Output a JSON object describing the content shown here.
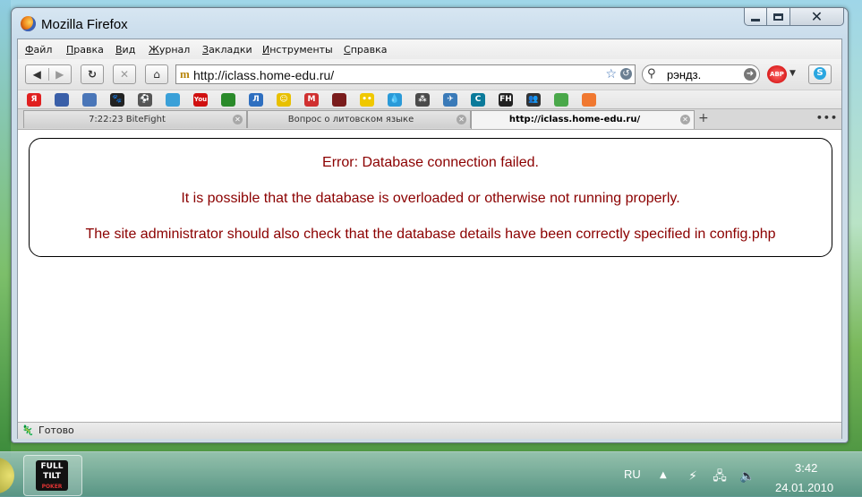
{
  "window": {
    "title": "Mozilla Firefox"
  },
  "menu": [
    "Файл",
    "Правка",
    "Вид",
    "Журнал",
    "Закладки",
    "Инструменты",
    "Справка"
  ],
  "nav": {
    "url": "http://iclass.home-edu.ru/",
    "url_favicon": "m",
    "search_text": "рэндз.",
    "abp_label": "ABP"
  },
  "bookmarks": [
    {
      "icon": "yandex-icon",
      "glyph": "Я",
      "color": "#e02020"
    },
    {
      "icon": "folder-icon",
      "glyph": "",
      "color": "#3a5fa8"
    },
    {
      "icon": "computer-icon",
      "glyph": "",
      "color": "#4a76b8"
    },
    {
      "icon": "paw-icon",
      "glyph": "🐾",
      "color": "#222"
    },
    {
      "icon": "ball-icon",
      "glyph": "⚽",
      "color": "#555"
    },
    {
      "icon": "chart-icon",
      "glyph": "",
      "color": "#3aa0d8"
    },
    {
      "icon": "youtube-icon",
      "glyph": "You",
      "color": "#d01010"
    },
    {
      "icon": "green-box-icon",
      "glyph": "",
      "color": "#2a8a2a"
    },
    {
      "icon": "blue-a-icon",
      "glyph": "Л",
      "color": "#2e6fc0"
    },
    {
      "icon": "smiley-icon",
      "glyph": "☺",
      "color": "#e8c000"
    },
    {
      "icon": "gmail-icon",
      "glyph": "M",
      "color": "#d03030"
    },
    {
      "icon": "dark-box-icon",
      "glyph": "",
      "color": "#7a1c1c"
    },
    {
      "icon": "yellow-face-icon",
      "glyph": "••",
      "color": "#f0c800"
    },
    {
      "icon": "drop-icon",
      "glyph": "💧",
      "color": "#2a9ad8"
    },
    {
      "icon": "dots-icon",
      "glyph": "⁂",
      "color": "#4a4a4a"
    },
    {
      "icon": "bird-icon",
      "glyph": "✈",
      "color": "#3a7ab8"
    },
    {
      "icon": "c-icon",
      "glyph": "C",
      "color": "#0a7a9a"
    },
    {
      "icon": "fh-icon",
      "glyph": "FH",
      "color": "#222"
    },
    {
      "icon": "people-icon",
      "glyph": "👥",
      "color": "#333"
    },
    {
      "icon": "green-swirl-icon",
      "glyph": "",
      "color": "#4aa84a"
    },
    {
      "icon": "orange-circle-icon",
      "glyph": "",
      "color": "#f07830"
    }
  ],
  "tabs": [
    {
      "label": "7:22:23 BiteFight"
    },
    {
      "label": "Вопрос о литовском языке"
    },
    {
      "label": "http://iclass.home-edu.ru/"
    }
  ],
  "content": {
    "line1": "Error: Database connection failed.",
    "line2": "It is possible that the database is overloaded or otherwise not running properly.",
    "line3": "The site administrator should also check that the database details have been correctly specified in config.php"
  },
  "status": {
    "text": "Готово"
  },
  "taskbar": {
    "app_label": "FULL TILT",
    "app_sub": "POKER",
    "lang": "RU",
    "time": "3:42",
    "date": "24.01.2010"
  }
}
